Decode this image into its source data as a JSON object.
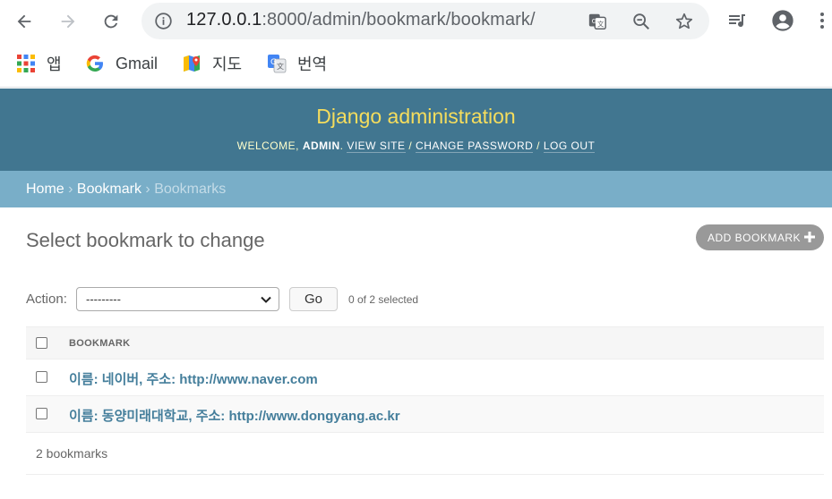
{
  "browser": {
    "url_host": "127.0.0.1",
    "url_rest": ":8000/admin/bookmark/bookmark/",
    "bookmarks": [
      {
        "label": "앱",
        "icon": "apps-grid-icon"
      },
      {
        "label": "Gmail",
        "icon": "google-g-icon"
      },
      {
        "label": "지도",
        "icon": "maps-icon"
      },
      {
        "label": "번역",
        "icon": "translate-icon"
      }
    ]
  },
  "header": {
    "branding": "Django administration",
    "welcome": "Welcome,",
    "user": "admin",
    "view_site": "View site",
    "change_password": "Change password",
    "log_out": "Log out",
    "sep": "/"
  },
  "breadcrumbs": {
    "home": "Home",
    "app": "Bookmark",
    "current": "Bookmarks",
    "sep": "›"
  },
  "content": {
    "title": "Select bookmark to change",
    "add_button": "ADD BOOKMARK"
  },
  "actions": {
    "label": "Action:",
    "selected_option": "---------",
    "go": "Go",
    "counter": "0 of 2 selected"
  },
  "table": {
    "header": "BOOKMARK",
    "rows": [
      "이름: 네이버, 주소: http://www.naver.com",
      "이름: 동양미래대학교, 주소: http://www.dongyang.ac.kr"
    ],
    "footer": "2 bookmarks"
  },
  "colors": {
    "header_bg": "#417690",
    "branding": "#f5dd5d",
    "breadcrumb_bg": "#79aec8",
    "link": "#447e9b"
  }
}
